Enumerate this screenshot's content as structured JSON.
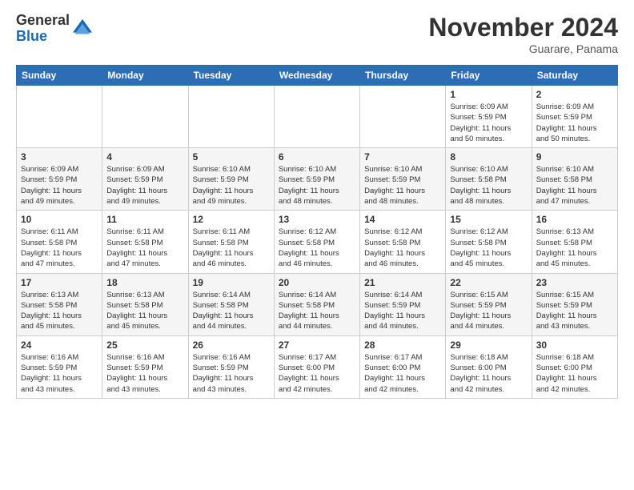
{
  "header": {
    "logo_general": "General",
    "logo_blue": "Blue",
    "title": "November 2024",
    "location": "Guarare, Panama"
  },
  "weekdays": [
    "Sunday",
    "Monday",
    "Tuesday",
    "Wednesday",
    "Thursday",
    "Friday",
    "Saturday"
  ],
  "weeks": [
    [
      {
        "day": "",
        "info": ""
      },
      {
        "day": "",
        "info": ""
      },
      {
        "day": "",
        "info": ""
      },
      {
        "day": "",
        "info": ""
      },
      {
        "day": "",
        "info": ""
      },
      {
        "day": "1",
        "info": "Sunrise: 6:09 AM\nSunset: 5:59 PM\nDaylight: 11 hours\nand 50 minutes."
      },
      {
        "day": "2",
        "info": "Sunrise: 6:09 AM\nSunset: 5:59 PM\nDaylight: 11 hours\nand 50 minutes."
      }
    ],
    [
      {
        "day": "3",
        "info": "Sunrise: 6:09 AM\nSunset: 5:59 PM\nDaylight: 11 hours\nand 49 minutes."
      },
      {
        "day": "4",
        "info": "Sunrise: 6:09 AM\nSunset: 5:59 PM\nDaylight: 11 hours\nand 49 minutes."
      },
      {
        "day": "5",
        "info": "Sunrise: 6:10 AM\nSunset: 5:59 PM\nDaylight: 11 hours\nand 49 minutes."
      },
      {
        "day": "6",
        "info": "Sunrise: 6:10 AM\nSunset: 5:59 PM\nDaylight: 11 hours\nand 48 minutes."
      },
      {
        "day": "7",
        "info": "Sunrise: 6:10 AM\nSunset: 5:59 PM\nDaylight: 11 hours\nand 48 minutes."
      },
      {
        "day": "8",
        "info": "Sunrise: 6:10 AM\nSunset: 5:58 PM\nDaylight: 11 hours\nand 48 minutes."
      },
      {
        "day": "9",
        "info": "Sunrise: 6:10 AM\nSunset: 5:58 PM\nDaylight: 11 hours\nand 47 minutes."
      }
    ],
    [
      {
        "day": "10",
        "info": "Sunrise: 6:11 AM\nSunset: 5:58 PM\nDaylight: 11 hours\nand 47 minutes."
      },
      {
        "day": "11",
        "info": "Sunrise: 6:11 AM\nSunset: 5:58 PM\nDaylight: 11 hours\nand 47 minutes."
      },
      {
        "day": "12",
        "info": "Sunrise: 6:11 AM\nSunset: 5:58 PM\nDaylight: 11 hours\nand 46 minutes."
      },
      {
        "day": "13",
        "info": "Sunrise: 6:12 AM\nSunset: 5:58 PM\nDaylight: 11 hours\nand 46 minutes."
      },
      {
        "day": "14",
        "info": "Sunrise: 6:12 AM\nSunset: 5:58 PM\nDaylight: 11 hours\nand 46 minutes."
      },
      {
        "day": "15",
        "info": "Sunrise: 6:12 AM\nSunset: 5:58 PM\nDaylight: 11 hours\nand 45 minutes."
      },
      {
        "day": "16",
        "info": "Sunrise: 6:13 AM\nSunset: 5:58 PM\nDaylight: 11 hours\nand 45 minutes."
      }
    ],
    [
      {
        "day": "17",
        "info": "Sunrise: 6:13 AM\nSunset: 5:58 PM\nDaylight: 11 hours\nand 45 minutes."
      },
      {
        "day": "18",
        "info": "Sunrise: 6:13 AM\nSunset: 5:58 PM\nDaylight: 11 hours\nand 45 minutes."
      },
      {
        "day": "19",
        "info": "Sunrise: 6:14 AM\nSunset: 5:58 PM\nDaylight: 11 hours\nand 44 minutes."
      },
      {
        "day": "20",
        "info": "Sunrise: 6:14 AM\nSunset: 5:58 PM\nDaylight: 11 hours\nand 44 minutes."
      },
      {
        "day": "21",
        "info": "Sunrise: 6:14 AM\nSunset: 5:59 PM\nDaylight: 11 hours\nand 44 minutes."
      },
      {
        "day": "22",
        "info": "Sunrise: 6:15 AM\nSunset: 5:59 PM\nDaylight: 11 hours\nand 44 minutes."
      },
      {
        "day": "23",
        "info": "Sunrise: 6:15 AM\nSunset: 5:59 PM\nDaylight: 11 hours\nand 43 minutes."
      }
    ],
    [
      {
        "day": "24",
        "info": "Sunrise: 6:16 AM\nSunset: 5:59 PM\nDaylight: 11 hours\nand 43 minutes."
      },
      {
        "day": "25",
        "info": "Sunrise: 6:16 AM\nSunset: 5:59 PM\nDaylight: 11 hours\nand 43 minutes."
      },
      {
        "day": "26",
        "info": "Sunrise: 6:16 AM\nSunset: 5:59 PM\nDaylight: 11 hours\nand 43 minutes."
      },
      {
        "day": "27",
        "info": "Sunrise: 6:17 AM\nSunset: 6:00 PM\nDaylight: 11 hours\nand 42 minutes."
      },
      {
        "day": "28",
        "info": "Sunrise: 6:17 AM\nSunset: 6:00 PM\nDaylight: 11 hours\nand 42 minutes."
      },
      {
        "day": "29",
        "info": "Sunrise: 6:18 AM\nSunset: 6:00 PM\nDaylight: 11 hours\nand 42 minutes."
      },
      {
        "day": "30",
        "info": "Sunrise: 6:18 AM\nSunset: 6:00 PM\nDaylight: 11 hours\nand 42 minutes."
      }
    ]
  ]
}
